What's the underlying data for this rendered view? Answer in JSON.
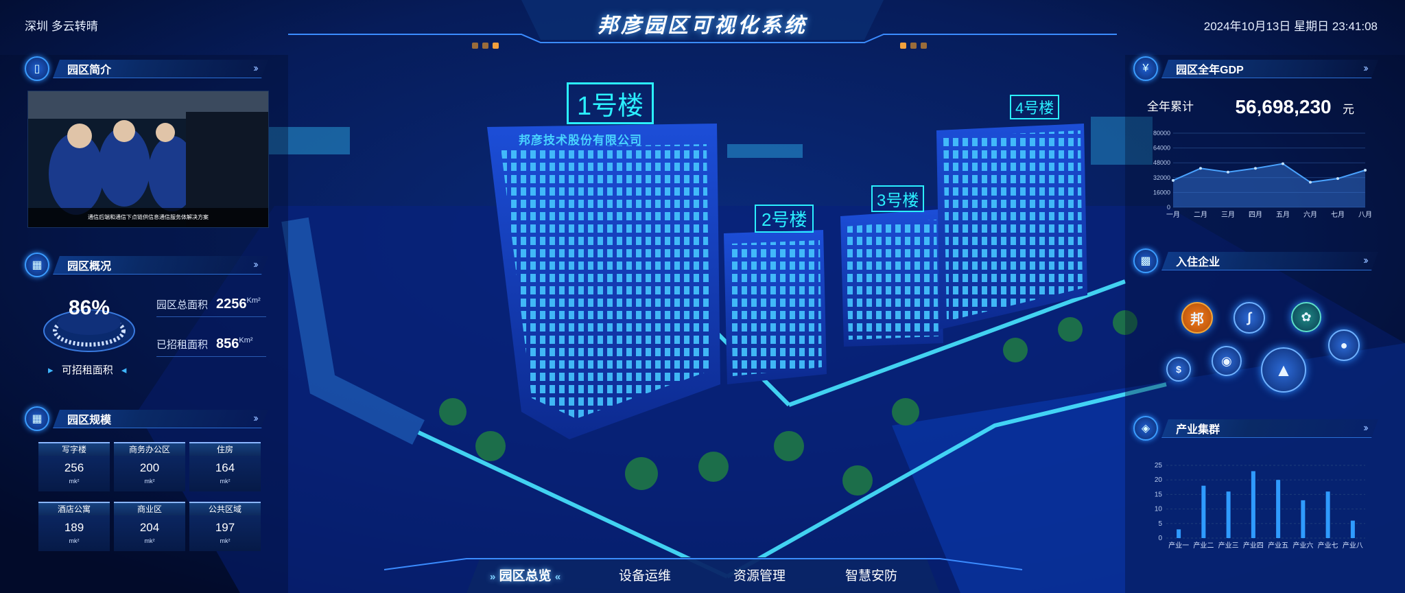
{
  "header": {
    "location_weather": "深圳 多云转晴",
    "title": "邦彦园区可视化系统",
    "datetime": "2024年10月13日 星期日 23:41:08"
  },
  "panels": {
    "intro": {
      "title": "园区简介",
      "video_caption": "通信后端和通信下点链供信息通信服务体解决方案"
    },
    "overview": {
      "title": "园区概况",
      "gauge_value": "86%",
      "gauge_caption": "可招租面积",
      "total_area_label": "园区总面积",
      "total_area_value": "2256",
      "total_area_unit": "Km²",
      "rented_area_label": "已招租面积",
      "rented_area_value": "856",
      "rented_area_unit": "Km²"
    },
    "scale": {
      "title": "园区规模",
      "items": [
        {
          "label": "写字楼",
          "value": "256",
          "unit": "mk²"
        },
        {
          "label": "商务办公区",
          "value": "200",
          "unit": "mk²"
        },
        {
          "label": "住房",
          "value": "164",
          "unit": "mk²"
        },
        {
          "label": "酒店公寓",
          "value": "189",
          "unit": "mk²"
        },
        {
          "label": "商业区",
          "value": "204",
          "unit": "mk²"
        },
        {
          "label": "公共区域",
          "value": "197",
          "unit": "mk²"
        }
      ]
    },
    "gdp": {
      "title": "园区全年GDP",
      "total_label": "全年累计",
      "total_value": "56,698,230",
      "total_unit": "元"
    },
    "enterprises": {
      "title": "入住企业",
      "featured_logo": "邦"
    },
    "industry": {
      "title": "产业集群"
    }
  },
  "scene": {
    "building_labels": [
      "1号楼",
      "2号楼",
      "3号楼",
      "4号楼"
    ],
    "building1_sign": "邦彦技术股份有限公司"
  },
  "nav": {
    "items": [
      "园区总览",
      "设备运维",
      "资源管理",
      "智慧安防"
    ],
    "active": "园区总览"
  },
  "chart_data": [
    {
      "type": "area",
      "categories": [
        "一月",
        "二月",
        "三月",
        "四月",
        "五月",
        "六月",
        "七月",
        "八月"
      ],
      "values": [
        29000,
        42000,
        38000,
        42000,
        47000,
        27000,
        31000,
        40000
      ],
      "yticks": [
        0,
        16000,
        32000,
        48000,
        64000,
        80000
      ],
      "ylim": [
        0,
        80000
      ],
      "color": "#4aa3ff"
    },
    {
      "type": "bar",
      "categories": [
        "产业一",
        "产业二",
        "产业三",
        "产业四",
        "产业五",
        "产业六",
        "产业七",
        "产业八"
      ],
      "values": [
        3,
        18,
        16,
        23,
        20,
        13,
        16,
        6
      ],
      "yticks": [
        0,
        5,
        10,
        15,
        20,
        25
      ],
      "ylim": [
        0,
        25
      ],
      "color": "#2f9bff"
    }
  ]
}
